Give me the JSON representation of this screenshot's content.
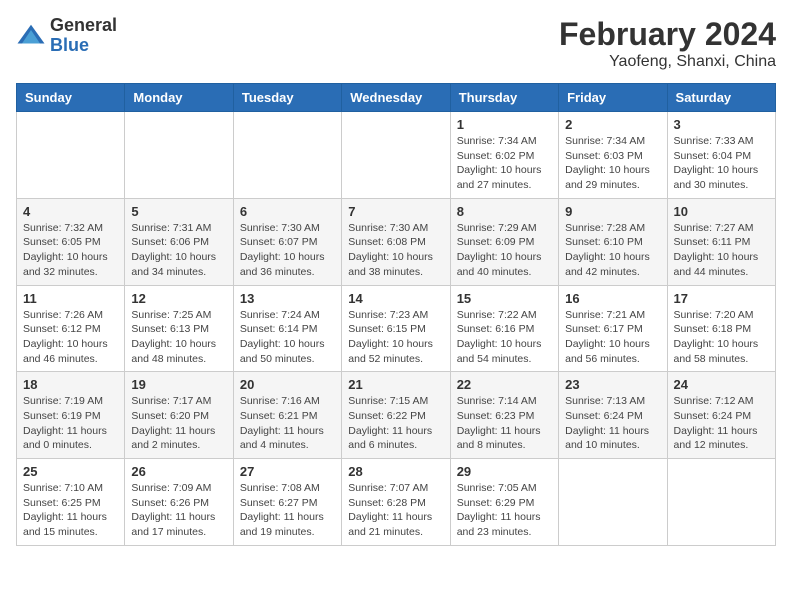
{
  "logo": {
    "general": "General",
    "blue": "Blue"
  },
  "title": "February 2024",
  "subtitle": "Yaofeng, Shanxi, China",
  "days": [
    "Sunday",
    "Monday",
    "Tuesday",
    "Wednesday",
    "Thursday",
    "Friday",
    "Saturday"
  ],
  "weeks": [
    [
      {
        "day": "",
        "info": ""
      },
      {
        "day": "",
        "info": ""
      },
      {
        "day": "",
        "info": ""
      },
      {
        "day": "",
        "info": ""
      },
      {
        "day": "1",
        "info": "Sunrise: 7:34 AM\nSunset: 6:02 PM\nDaylight: 10 hours\nand 27 minutes."
      },
      {
        "day": "2",
        "info": "Sunrise: 7:34 AM\nSunset: 6:03 PM\nDaylight: 10 hours\nand 29 minutes."
      },
      {
        "day": "3",
        "info": "Sunrise: 7:33 AM\nSunset: 6:04 PM\nDaylight: 10 hours\nand 30 minutes."
      }
    ],
    [
      {
        "day": "4",
        "info": "Sunrise: 7:32 AM\nSunset: 6:05 PM\nDaylight: 10 hours\nand 32 minutes."
      },
      {
        "day": "5",
        "info": "Sunrise: 7:31 AM\nSunset: 6:06 PM\nDaylight: 10 hours\nand 34 minutes."
      },
      {
        "day": "6",
        "info": "Sunrise: 7:30 AM\nSunset: 6:07 PM\nDaylight: 10 hours\nand 36 minutes."
      },
      {
        "day": "7",
        "info": "Sunrise: 7:30 AM\nSunset: 6:08 PM\nDaylight: 10 hours\nand 38 minutes."
      },
      {
        "day": "8",
        "info": "Sunrise: 7:29 AM\nSunset: 6:09 PM\nDaylight: 10 hours\nand 40 minutes."
      },
      {
        "day": "9",
        "info": "Sunrise: 7:28 AM\nSunset: 6:10 PM\nDaylight: 10 hours\nand 42 minutes."
      },
      {
        "day": "10",
        "info": "Sunrise: 7:27 AM\nSunset: 6:11 PM\nDaylight: 10 hours\nand 44 minutes."
      }
    ],
    [
      {
        "day": "11",
        "info": "Sunrise: 7:26 AM\nSunset: 6:12 PM\nDaylight: 10 hours\nand 46 minutes."
      },
      {
        "day": "12",
        "info": "Sunrise: 7:25 AM\nSunset: 6:13 PM\nDaylight: 10 hours\nand 48 minutes."
      },
      {
        "day": "13",
        "info": "Sunrise: 7:24 AM\nSunset: 6:14 PM\nDaylight: 10 hours\nand 50 minutes."
      },
      {
        "day": "14",
        "info": "Sunrise: 7:23 AM\nSunset: 6:15 PM\nDaylight: 10 hours\nand 52 minutes."
      },
      {
        "day": "15",
        "info": "Sunrise: 7:22 AM\nSunset: 6:16 PM\nDaylight: 10 hours\nand 54 minutes."
      },
      {
        "day": "16",
        "info": "Sunrise: 7:21 AM\nSunset: 6:17 PM\nDaylight: 10 hours\nand 56 minutes."
      },
      {
        "day": "17",
        "info": "Sunrise: 7:20 AM\nSunset: 6:18 PM\nDaylight: 10 hours\nand 58 minutes."
      }
    ],
    [
      {
        "day": "18",
        "info": "Sunrise: 7:19 AM\nSunset: 6:19 PM\nDaylight: 11 hours\nand 0 minutes."
      },
      {
        "day": "19",
        "info": "Sunrise: 7:17 AM\nSunset: 6:20 PM\nDaylight: 11 hours\nand 2 minutes."
      },
      {
        "day": "20",
        "info": "Sunrise: 7:16 AM\nSunset: 6:21 PM\nDaylight: 11 hours\nand 4 minutes."
      },
      {
        "day": "21",
        "info": "Sunrise: 7:15 AM\nSunset: 6:22 PM\nDaylight: 11 hours\nand 6 minutes."
      },
      {
        "day": "22",
        "info": "Sunrise: 7:14 AM\nSunset: 6:23 PM\nDaylight: 11 hours\nand 8 minutes."
      },
      {
        "day": "23",
        "info": "Sunrise: 7:13 AM\nSunset: 6:24 PM\nDaylight: 11 hours\nand 10 minutes."
      },
      {
        "day": "24",
        "info": "Sunrise: 7:12 AM\nSunset: 6:24 PM\nDaylight: 11 hours\nand 12 minutes."
      }
    ],
    [
      {
        "day": "25",
        "info": "Sunrise: 7:10 AM\nSunset: 6:25 PM\nDaylight: 11 hours\nand 15 minutes."
      },
      {
        "day": "26",
        "info": "Sunrise: 7:09 AM\nSunset: 6:26 PM\nDaylight: 11 hours\nand 17 minutes."
      },
      {
        "day": "27",
        "info": "Sunrise: 7:08 AM\nSunset: 6:27 PM\nDaylight: 11 hours\nand 19 minutes."
      },
      {
        "day": "28",
        "info": "Sunrise: 7:07 AM\nSunset: 6:28 PM\nDaylight: 11 hours\nand 21 minutes."
      },
      {
        "day": "29",
        "info": "Sunrise: 7:05 AM\nSunset: 6:29 PM\nDaylight: 11 hours\nand 23 minutes."
      },
      {
        "day": "",
        "info": ""
      },
      {
        "day": "",
        "info": ""
      }
    ]
  ]
}
